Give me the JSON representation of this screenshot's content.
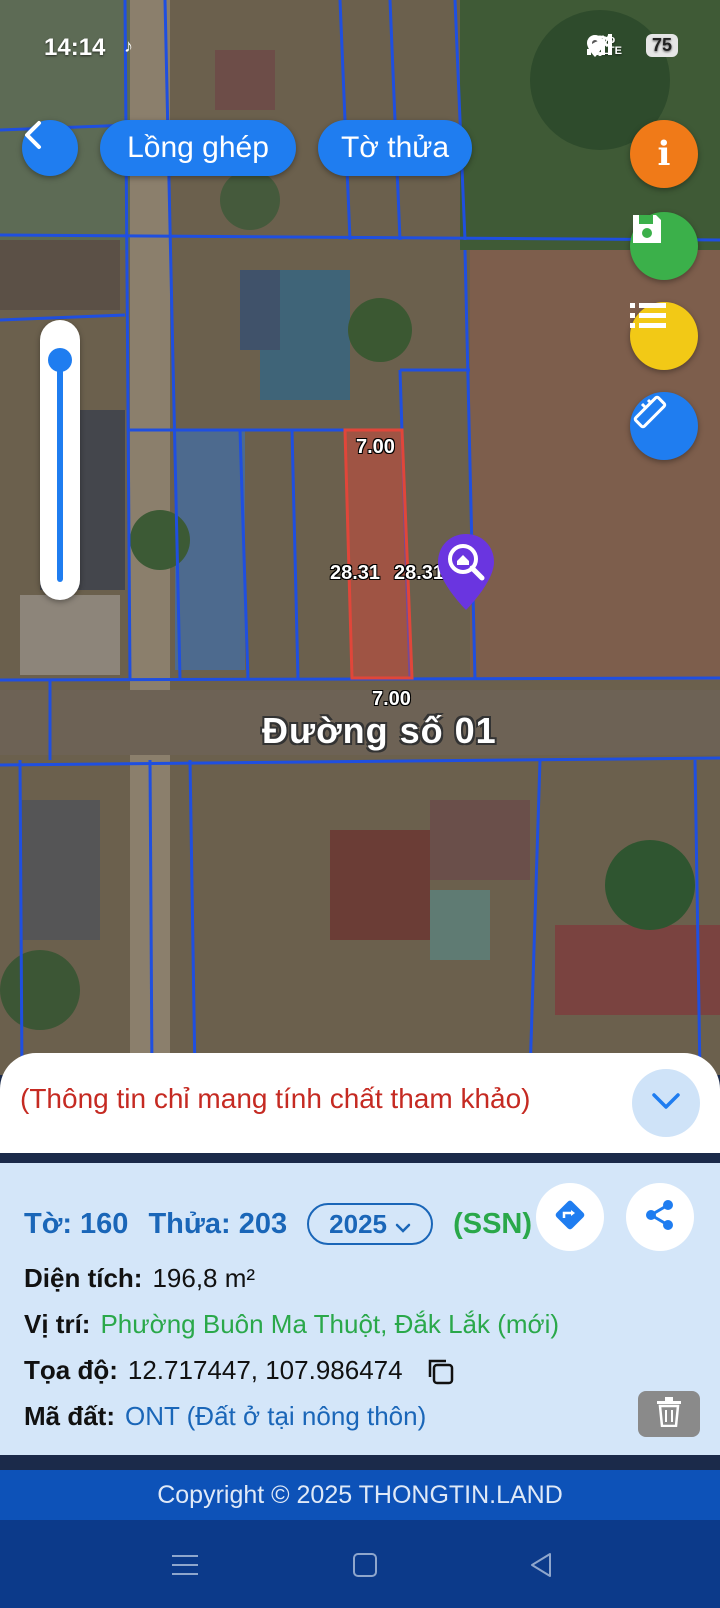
{
  "status_bar": {
    "time": "14:14",
    "battery": "75",
    "icons": [
      "tiktok-icon",
      "location-icon",
      "wifi-icon",
      "volte-icon",
      "signal-icon",
      "signal-icon"
    ]
  },
  "top_buttons": {
    "back_icon": "chevron-left-icon",
    "long_ghep": "Lồng ghép",
    "to_thua": "Tờ thửa"
  },
  "side_buttons": [
    "info-icon",
    "save-icon",
    "list-icon",
    "ruler-icon"
  ],
  "map": {
    "dim_top": "7.00",
    "dim_bottom": "7.00",
    "dim_left": "28.31",
    "dim_right": "28.31",
    "road_label": "Đường số 01",
    "pin_icon": "search-home-pin-icon"
  },
  "panel": {
    "note": "(Thông tin chỉ mang tính chất tham khảo)",
    "to": "Tờ: 160",
    "thua": "Thửa: 203",
    "year": "2025",
    "ssn": "(SSN)",
    "dien_tich_label": "Diện tích:",
    "dien_tich_value": "196,8 m²",
    "vi_tri_label": "Vị trí:",
    "vi_tri_value": "Phường Buôn Ma Thuột, Đắk Lắk (mới)",
    "toa_do_label": "Tọa độ:",
    "toa_do_value": "12.717447, 107.986474",
    "ma_dat_label": "Mã đất:",
    "ma_dat_value": "ONT (Đất ở tại nông thôn)"
  },
  "colors": {
    "primary": "#1f7df0",
    "green": "#2aa84a",
    "note_red": "#c52a22",
    "parcel_red": "#e0463a",
    "panel_bg": "#d4e6f9"
  },
  "footer": {
    "copyright": "Copyright © 2025 THONGTIN.LAND"
  }
}
